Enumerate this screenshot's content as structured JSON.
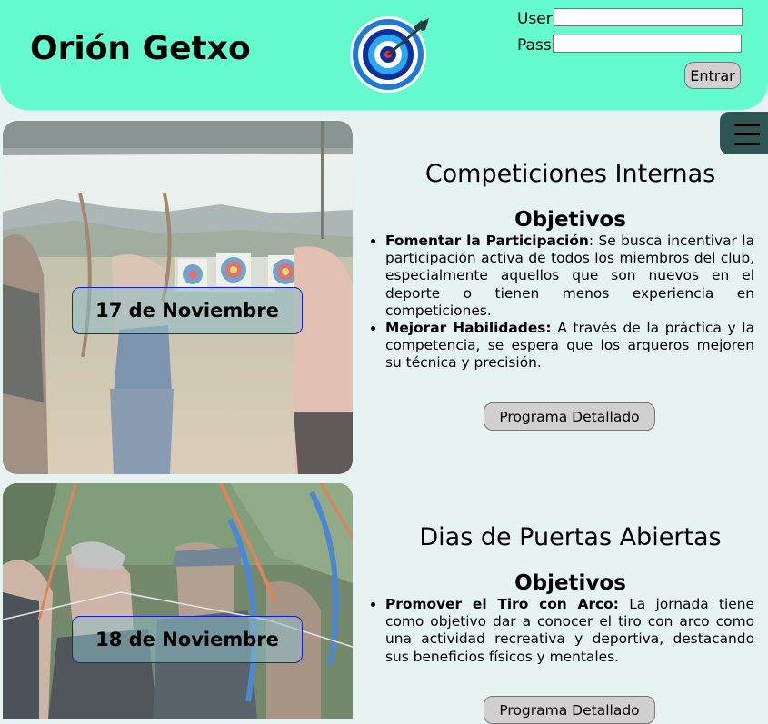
{
  "header": {
    "title": "Orión Getxo",
    "logo_icon": "archery-target-icon",
    "background": "#63fbcd"
  },
  "login": {
    "user_label": "User",
    "user_value": "",
    "pass_label": "Pass",
    "pass_value": "",
    "submit_label": "Entrar"
  },
  "menu": {
    "icon": "hamburger-menu-icon"
  },
  "events": [
    {
      "date": "17 de Noviembre",
      "title": "Competiciones Internas",
      "objectives_title": "Objetivos",
      "objectives": [
        {
          "heading": "Fomentar la Participación",
          "separator": ":",
          "text": " Se busca incentivar la participación activa de todos los miembros del club, especialmente aquellos que son nuevos en el deporte o tienen menos experiencia en competiciones."
        },
        {
          "heading": "Mejorar Habilidades:",
          "separator": "",
          "text": " A través de la práctica y la competencia, se espera que los arqueros mejoren su técnica y precisión."
        }
      ],
      "button_label": "Programa Detallado"
    },
    {
      "date": "18 de Noviembre",
      "title": "Dias de Puertas Abiertas",
      "objectives_title": "Objetivos",
      "objectives": [
        {
          "heading": "Promover el Tiro con Arco:",
          "separator": "",
          "text": " La jornada tiene como objetivo dar a conocer el tiro con arco como una actividad recreativa y deportiva, destacando sus beneficios físicos y mentales."
        }
      ],
      "button_label": "Programa Detallado"
    }
  ],
  "colors": {
    "page_background": "#e6f3f1",
    "menu_button": "#2f5555",
    "button": "#d2cfd0",
    "date_border": "#1c1cc8"
  }
}
